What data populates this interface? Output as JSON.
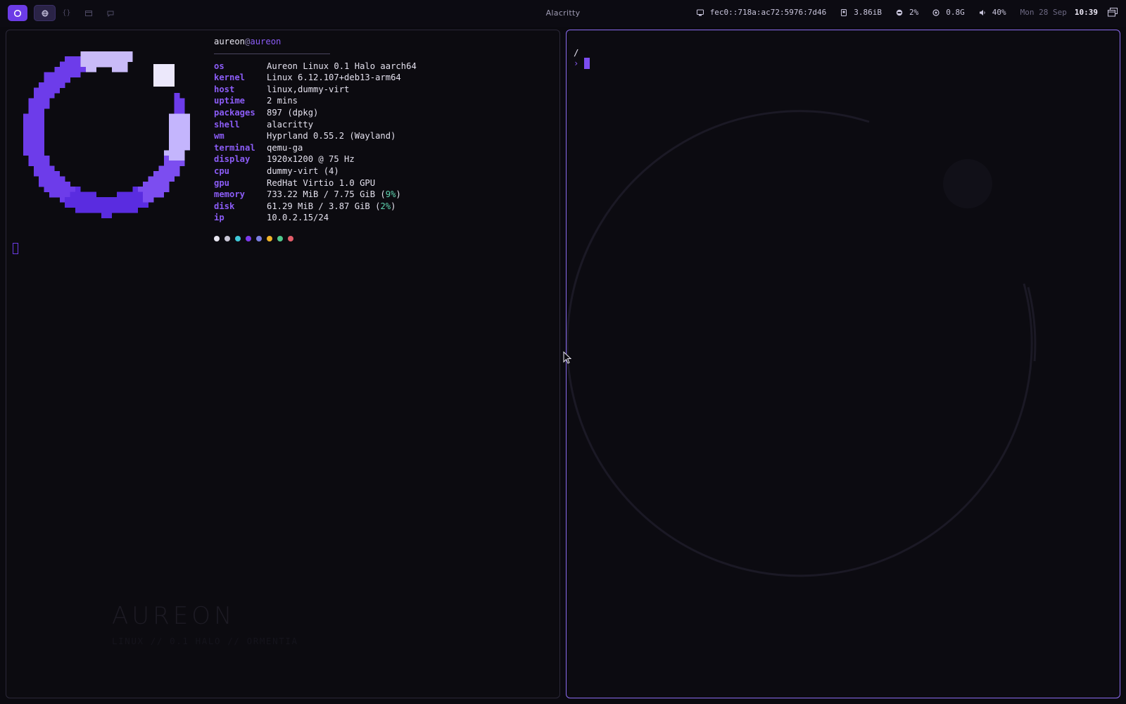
{
  "topbar": {
    "window_title": "Alacritty",
    "workspaces": [
      {
        "icon": "globe-icon",
        "active": true
      },
      {
        "icon": "braces-icon",
        "active": false
      },
      {
        "icon": "folder-icon",
        "active": false
      },
      {
        "icon": "chat-icon",
        "active": false
      }
    ],
    "network": "fec0::718a:ac72:5976:7d46",
    "memory": "3.86iB",
    "cpu": "2%",
    "gpu": "0.8G",
    "volume": "40%",
    "date": "Mon 28 Sep",
    "time": "10:39"
  },
  "fetch": {
    "user": "aureon",
    "at": "@",
    "host": "aureon",
    "rows": [
      {
        "key": "os",
        "value": "Aureon Linux 0.1 Halo aarch64"
      },
      {
        "key": "kernel",
        "value": "Linux 6.12.107+deb13-arm64"
      },
      {
        "key": "host",
        "value": "linux,dummy-virt"
      },
      {
        "key": "uptime",
        "value": "2 mins"
      },
      {
        "key": "packages",
        "value": "897 (dpkg)"
      },
      {
        "key": "shell",
        "value": "alacritty"
      },
      {
        "key": "wm",
        "value": "Hyprland 0.55.2 (Wayland)"
      },
      {
        "key": "terminal",
        "value": "qemu-ga"
      },
      {
        "key": "display",
        "value": "1920x1200 @ 75 Hz"
      },
      {
        "key": "cpu",
        "value": "dummy-virt (4)"
      },
      {
        "key": "gpu",
        "value": "RedHat Virtio 1.0 GPU"
      }
    ],
    "memory": {
      "key": "memory",
      "value": "733.22 MiB / 7.75 GiB (",
      "pct": "9%",
      "end": ")"
    },
    "disk": {
      "key": "disk",
      "value": "61.29 MiB / 3.87 GiB (",
      "pct": "2%",
      "end": ")"
    },
    "ip": {
      "key": "ip",
      "value": "10.0.2.15/24"
    },
    "palette": [
      "#e8e6f0",
      "#c9c6d6",
      "#3fc8d8",
      "#7c3aed",
      "#7b7fe0",
      "#f0b429",
      "#4fc98d",
      "#e35d6a"
    ]
  },
  "brand": {
    "title": "AUREON",
    "subtitle": "LINUX // 0.1 HALO // ORMENTIA"
  },
  "terminal_right": {
    "cwd": "/",
    "prompt_symbol": "›"
  },
  "colors": {
    "accent": "#8b5cf6",
    "accent_dark": "#6c3ce6",
    "background": "#0b0a10"
  }
}
